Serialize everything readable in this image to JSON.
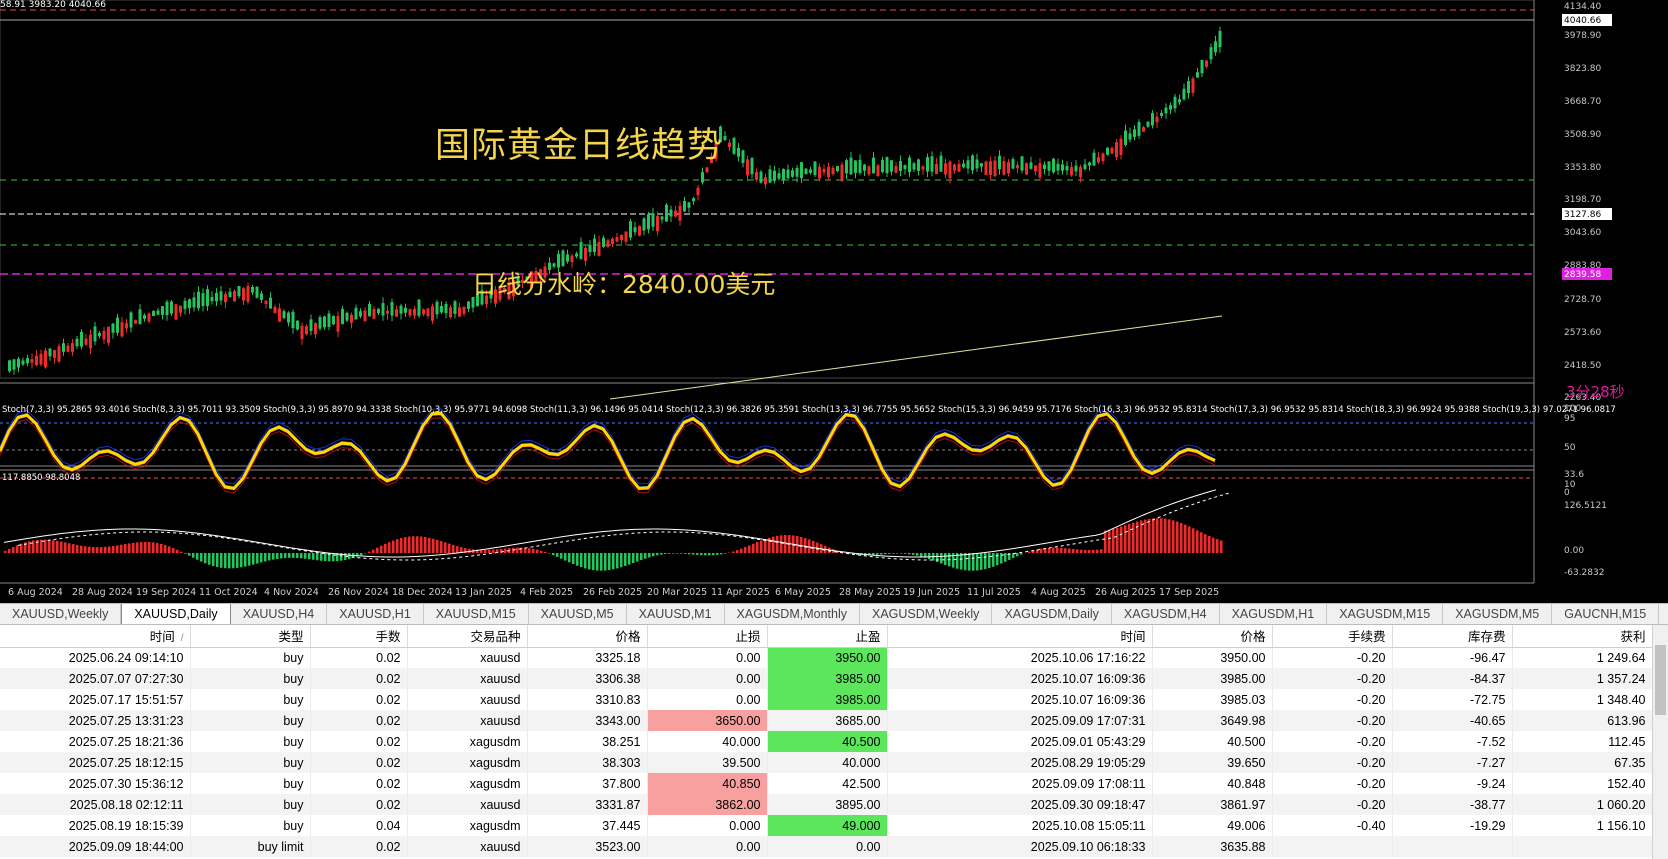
{
  "chart": {
    "ohlc_text": "58.91 3983.20 4040.66",
    "title_overlay": "国际黄金日线趋势",
    "watershed_overlay": "日线分水岭：2840.00美元",
    "countdown": "3分28秒",
    "price_axis": [
      "4134.40",
      "3978.90",
      "3823.80",
      "3668.70",
      "3508.90",
      "3353.80",
      "3198.70",
      "3043.60",
      "2883.80",
      "2728.70",
      "2573.60",
      "2418.50",
      "2263.40"
    ],
    "price_axis_tags": {
      "current": "4040.66",
      "white_line": "3127.86",
      "magenta_line": "2839.58"
    },
    "stoch_axis": [
      "100",
      "95",
      "50",
      "33.6",
      "10",
      "0"
    ],
    "macd_axis": [
      "126.5121",
      "0.00",
      "-63.2832"
    ],
    "macd_label": "117.8850 98.8048",
    "stoch_label": "Stoch(7,3,3) 95.2865 93.4016  Stoch(8,3,3) 95.7011 93.3509  Stoch(9,3,3) 95.8970 94.3338  Stoch(10,3,3) 95.9771 94.6098  Stoch(11,3,3) 96.1496 95.0414  Stoch(12,3,3) 96.3826 95.3591  Stoch(13,3,3) 96.7755 95.5652  Stoch(15,3,3) 96.9459 95.7176  Stoch(16,3,3) 96.9532 95.8314  Stoch(17,3,3) 96.9532 95.8314  Stoch(18,3,3) 96.9924 95.9388  Stoch(19,3,3) 97.0271 96.0817",
    "dates": [
      "6 Aug 2024",
      "28 Aug 2024",
      "19 Sep 2024",
      "11 Oct 2024",
      "4 Nov 2024",
      "26 Nov 2024",
      "18 Dec 2024",
      "13 Jan 2025",
      "4 Feb 2025",
      "26 Feb 2025",
      "20 Mar 2025",
      "11 Apr 2025",
      "6 May 2025",
      "28 May 2025",
      "19 Jun 2025",
      "11 Jul 2025",
      "4 Aug 2025",
      "26 Aug 2025",
      "17 Sep 2025"
    ],
    "colors": {
      "bull": "#22c55e",
      "bear": "#ef2b2b",
      "title": "#f2d54a",
      "magenta": "#e020e0",
      "stoch_yellow": "#ffd800"
    }
  },
  "tabs": [
    "XAUUSD,Weekly",
    "XAUUSD,Daily",
    "XAUUSD,H4",
    "XAUUSD,H1",
    "XAUUSD,M15",
    "XAUUSD,M5",
    "XAUUSD,M1",
    "XAGUSDM,Monthly",
    "XAGUSDM,Weekly",
    "XAGUSDM,Daily",
    "XAGUSDM,H4",
    "XAGUSDM,H1",
    "XAGUSDM,M15",
    "XAGUSDM,M5",
    "GAUCNH,M15"
  ],
  "active_tab": "XAUUSD,Daily",
  "table": {
    "headers": [
      "时间",
      "类型",
      "手数",
      "交易品种",
      "价格",
      "止损",
      "止盈",
      "时间",
      "价格",
      "手续费",
      "库存费",
      "获利"
    ],
    "sort_indicator": "/",
    "rows": [
      [
        "2025.06.24 09:14:10",
        "buy",
        "0.02",
        "xauusd",
        "3325.18",
        "0.00",
        "3950.00",
        "2025.10.06 17:16:22",
        "3950.00",
        "-0.20",
        "-96.47",
        "1 249.64"
      ],
      [
        "2025.07.07 07:27:30",
        "buy",
        "0.02",
        "xauusd",
        "3306.38",
        "0.00",
        "3985.00",
        "2025.10.07 16:09:36",
        "3985.00",
        "-0.20",
        "-84.37",
        "1 357.24"
      ],
      [
        "2025.07.17 15:51:57",
        "buy",
        "0.02",
        "xauusd",
        "3310.83",
        "0.00",
        "3985.00",
        "2025.10.07 16:09:36",
        "3985.03",
        "-0.20",
        "-72.75",
        "1 348.40"
      ],
      [
        "2025.07.25 13:31:23",
        "buy",
        "0.02",
        "xauusd",
        "3343.00",
        "3650.00",
        "3685.00",
        "2025.09.09 17:07:31",
        "3649.98",
        "-0.20",
        "-40.65",
        "613.96"
      ],
      [
        "2025.07.25 18:21:36",
        "buy",
        "0.02",
        "xagusdm",
        "38.251",
        "40.000",
        "40.500",
        "2025.09.01 05:43:29",
        "40.500",
        "-0.20",
        "-7.52",
        "112.45"
      ],
      [
        "2025.07.25 18:12:15",
        "buy",
        "0.02",
        "xagusdm",
        "38.303",
        "39.500",
        "40.000",
        "2025.08.29 19:05:29",
        "39.650",
        "-0.20",
        "-7.27",
        "67.35"
      ],
      [
        "2025.07.30 15:36:12",
        "buy",
        "0.02",
        "xagusdm",
        "37.800",
        "40.850",
        "42.500",
        "2025.09.09 17:08:11",
        "40.848",
        "-0.20",
        "-9.24",
        "152.40"
      ],
      [
        "2025.08.18 02:12:11",
        "buy",
        "0.02",
        "xauusd",
        "3331.87",
        "3862.00",
        "3895.00",
        "2025.09.30 09:18:47",
        "3861.97",
        "-0.20",
        "-38.77",
        "1 060.20"
      ],
      [
        "2025.08.19 18:15:39",
        "buy",
        "0.04",
        "xagusdm",
        "37.445",
        "0.000",
        "49.000",
        "2025.10.08 15:05:11",
        "49.006",
        "-0.40",
        "-19.29",
        "1 156.10"
      ],
      [
        "2025.09.09 18:44:00",
        "buy limit",
        "0.02",
        "xauusd",
        "3523.00",
        "0.00",
        "0.00",
        "2025.09.10 06:18:33",
        "3635.88",
        "",
        "",
        ""
      ]
    ],
    "highlights": {
      "sl_hit_rows": [
        3,
        6,
        7
      ],
      "tp_hit_rows": [
        0,
        1,
        2,
        4,
        8
      ]
    }
  }
}
